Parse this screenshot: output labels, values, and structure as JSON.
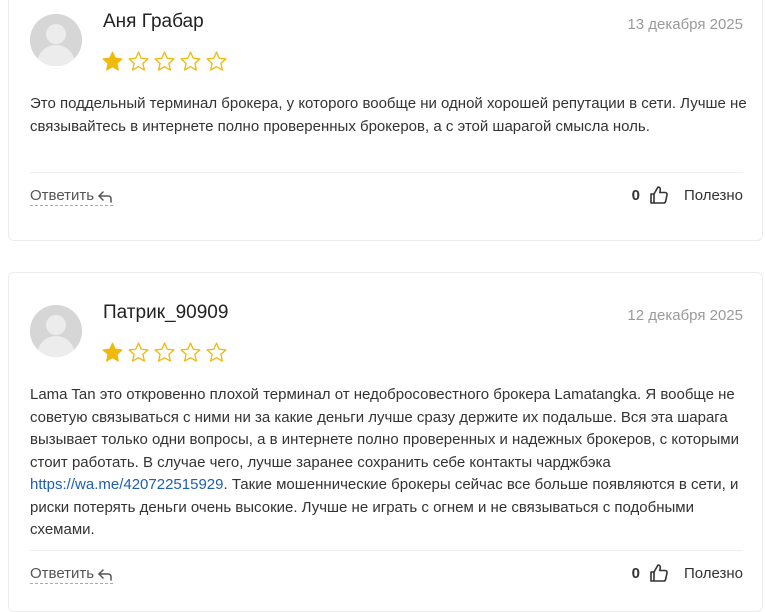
{
  "reviews": [
    {
      "author": "Аня Грабар",
      "date": "13 декабря 2025",
      "rating": 1,
      "rating_max": 5,
      "text_parts": [
        "Это поддельный терминал брокера, у которого вообще ни одной хорошей репутации в сети. Лучше не связывайтесь в интернете полно проверенных брокеров, а с этой шарагой смысла ноль."
      ],
      "reply_label": "Ответить",
      "helpful_count": "0",
      "helpful_label": "Полезно"
    },
    {
      "author": "Патрик_90909",
      "date": "12 декабря 2025",
      "rating": 1,
      "rating_max": 5,
      "text_before_link": "Lama Tan это откровенно плохой терминал от недобросовестного брокера Lamatangka. Я вообще не советую связываться с ними ни за какие деньги лучше сразу держите их подальше. Вся эта шарага вызывает только одни вопросы, а в интернете полно проверенных и надежных брокеров, с которыми стоит работать. В случае чего, лучше заранее сохранить себе контакты чарджбэка ",
      "link_text": "https://wa.me/420722515929",
      "text_after_link": ". Такие мошеннические брокеры сейчас все больше появляются в сети, и риски потерять деньги очень высокие. Лучше не играть с огнем и не связываться с подобными схемами.",
      "reply_label": "Ответить",
      "helpful_count": "0",
      "helpful_label": "Полезно"
    }
  ],
  "colors": {
    "star_filled": "#f0b90b",
    "star_empty_stroke": "#f0b90b",
    "link": "#1e5fae",
    "date": "#9a9a9a"
  },
  "icons": {
    "avatar": "user-avatar-placeholder",
    "reply": "reply-arrow-icon",
    "helpful": "thumbs-up-icon",
    "rating": "star-icon"
  }
}
